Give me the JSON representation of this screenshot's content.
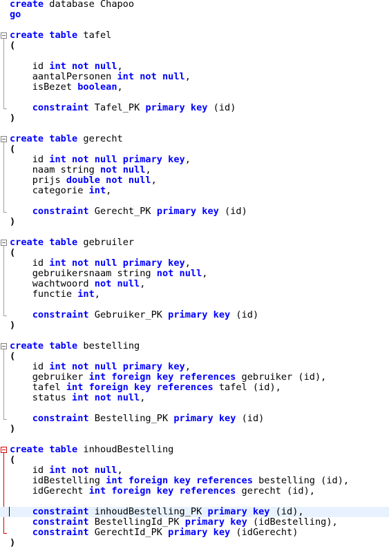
{
  "editor": {
    "current_line": 50,
    "caret_line": 50,
    "fold_regions": [
      {
        "start": 4,
        "end": 11,
        "active": false
      },
      {
        "start": 14,
        "end": 21,
        "active": false
      },
      {
        "start": 24,
        "end": 31,
        "active": false
      },
      {
        "start": 34,
        "end": 41,
        "active": false
      },
      {
        "start": 44,
        "end": 52,
        "active": true
      }
    ],
    "lines": [
      [
        {
          "t": "create",
          "c": "kw"
        },
        {
          "t": " database Chapoo",
          "c": "id"
        }
      ],
      [
        {
          "t": "go",
          "c": "kw"
        }
      ],
      [],
      [
        {
          "t": "create",
          "c": "kw"
        },
        {
          "t": " ",
          "c": "id"
        },
        {
          "t": "table",
          "c": "kw"
        },
        {
          "t": " tafel",
          "c": "id"
        }
      ],
      [
        {
          "t": "(",
          "c": "paren"
        }
      ],
      [],
      [
        {
          "t": "    id ",
          "c": "id"
        },
        {
          "t": "int not null",
          "c": "kw"
        },
        {
          "t": ",",
          "c": "id"
        }
      ],
      [
        {
          "t": "    aantalPersonen ",
          "c": "id"
        },
        {
          "t": "int not null",
          "c": "kw"
        },
        {
          "t": ",",
          "c": "id"
        }
      ],
      [
        {
          "t": "    isBezet ",
          "c": "id"
        },
        {
          "t": "boolean",
          "c": "kw"
        },
        {
          "t": ",",
          "c": "id"
        }
      ],
      [],
      [
        {
          "t": "    ",
          "c": "id"
        },
        {
          "t": "constraint",
          "c": "kw"
        },
        {
          "t": " Tafel_PK ",
          "c": "id"
        },
        {
          "t": "primary key",
          "c": "kw"
        },
        {
          "t": " (id)",
          "c": "id"
        }
      ],
      [
        {
          "t": ")",
          "c": "paren"
        }
      ],
      [],
      [
        {
          "t": "create",
          "c": "kw"
        },
        {
          "t": " ",
          "c": "id"
        },
        {
          "t": "table",
          "c": "kw"
        },
        {
          "t": " gerecht",
          "c": "id"
        }
      ],
      [
        {
          "t": "(",
          "c": "paren"
        }
      ],
      [
        {
          "t": "    id ",
          "c": "id"
        },
        {
          "t": "int not null primary key",
          "c": "kw"
        },
        {
          "t": ",",
          "c": "id"
        }
      ],
      [
        {
          "t": "    naam string ",
          "c": "id"
        },
        {
          "t": "not null",
          "c": "kw"
        },
        {
          "t": ",",
          "c": "id"
        }
      ],
      [
        {
          "t": "    prijs ",
          "c": "id"
        },
        {
          "t": "double not null",
          "c": "kw"
        },
        {
          "t": ",",
          "c": "id"
        }
      ],
      [
        {
          "t": "    categorie ",
          "c": "id"
        },
        {
          "t": "int",
          "c": "kw"
        },
        {
          "t": ",",
          "c": "id"
        }
      ],
      [],
      [
        {
          "t": "    ",
          "c": "id"
        },
        {
          "t": "constraint",
          "c": "kw"
        },
        {
          "t": " Gerecht_PK ",
          "c": "id"
        },
        {
          "t": "primary key",
          "c": "kw"
        },
        {
          "t": " (id)",
          "c": "id"
        }
      ],
      [
        {
          "t": ")",
          "c": "paren"
        }
      ],
      [],
      [
        {
          "t": "create",
          "c": "kw"
        },
        {
          "t": " ",
          "c": "id"
        },
        {
          "t": "table",
          "c": "kw"
        },
        {
          "t": " gebruiler",
          "c": "id"
        }
      ],
      [
        {
          "t": "(",
          "c": "paren"
        }
      ],
      [
        {
          "t": "    id ",
          "c": "id"
        },
        {
          "t": "int not null primary key",
          "c": "kw"
        },
        {
          "t": ",",
          "c": "id"
        }
      ],
      [
        {
          "t": "    gebruikersnaam string ",
          "c": "id"
        },
        {
          "t": "not null",
          "c": "kw"
        },
        {
          "t": ",",
          "c": "id"
        }
      ],
      [
        {
          "t": "    wachtwoord ",
          "c": "id"
        },
        {
          "t": "not null",
          "c": "kw"
        },
        {
          "t": ",",
          "c": "id"
        }
      ],
      [
        {
          "t": "    functie ",
          "c": "id"
        },
        {
          "t": "int",
          "c": "kw"
        },
        {
          "t": ",",
          "c": "id"
        }
      ],
      [],
      [
        {
          "t": "    ",
          "c": "id"
        },
        {
          "t": "constraint",
          "c": "kw"
        },
        {
          "t": " Gebruiker_PK ",
          "c": "id"
        },
        {
          "t": "primary key",
          "c": "kw"
        },
        {
          "t": " (id)",
          "c": "id"
        }
      ],
      [
        {
          "t": ")",
          "c": "paren"
        }
      ],
      [],
      [
        {
          "t": "create",
          "c": "kw"
        },
        {
          "t": " ",
          "c": "id"
        },
        {
          "t": "table",
          "c": "kw"
        },
        {
          "t": " bestelling",
          "c": "id"
        }
      ],
      [
        {
          "t": "(",
          "c": "paren"
        }
      ],
      [
        {
          "t": "    id ",
          "c": "id"
        },
        {
          "t": "int not null primary key",
          "c": "kw"
        },
        {
          "t": ",",
          "c": "id"
        }
      ],
      [
        {
          "t": "    gebruiker ",
          "c": "id"
        },
        {
          "t": "int foreign key references",
          "c": "kw"
        },
        {
          "t": " gebruiker (id),",
          "c": "id"
        }
      ],
      [
        {
          "t": "    tafel ",
          "c": "id"
        },
        {
          "t": "int foreign key references",
          "c": "kw"
        },
        {
          "t": " tafel (id),",
          "c": "id"
        }
      ],
      [
        {
          "t": "    status ",
          "c": "id"
        },
        {
          "t": "int not null",
          "c": "kw"
        },
        {
          "t": ",",
          "c": "id"
        }
      ],
      [],
      [
        {
          "t": "    ",
          "c": "id"
        },
        {
          "t": "constraint",
          "c": "kw"
        },
        {
          "t": " Bestelling_PK ",
          "c": "id"
        },
        {
          "t": "primary key",
          "c": "kw"
        },
        {
          "t": " (id)",
          "c": "id"
        }
      ],
      [
        {
          "t": ")",
          "c": "paren"
        }
      ],
      [],
      [
        {
          "t": "create",
          "c": "kw"
        },
        {
          "t": " ",
          "c": "id"
        },
        {
          "t": "table",
          "c": "kw"
        },
        {
          "t": " inhoudBestelling",
          "c": "id"
        }
      ],
      [
        {
          "t": "(",
          "c": "paren"
        }
      ],
      [
        {
          "t": "    id ",
          "c": "id"
        },
        {
          "t": "int not null",
          "c": "kw"
        },
        {
          "t": ",",
          "c": "id"
        }
      ],
      [
        {
          "t": "    idBestelling ",
          "c": "id"
        },
        {
          "t": "int foreign key references",
          "c": "kw"
        },
        {
          "t": " bestelling (id),",
          "c": "id"
        }
      ],
      [
        {
          "t": "    idGerecht ",
          "c": "id"
        },
        {
          "t": "int foreign key references",
          "c": "kw"
        },
        {
          "t": " gerecht (id),",
          "c": "id"
        }
      ],
      [],
      [
        {
          "t": "    ",
          "c": "id"
        },
        {
          "t": "constraint",
          "c": "kw"
        },
        {
          "t": " inhoudBestelling_PK ",
          "c": "id"
        },
        {
          "t": "primary key",
          "c": "kw"
        },
        {
          "t": " (id),",
          "c": "id"
        }
      ],
      [
        {
          "t": "    ",
          "c": "id"
        },
        {
          "t": "constraint",
          "c": "kw"
        },
        {
          "t": " BestellingId_PK ",
          "c": "id"
        },
        {
          "t": "primary key",
          "c": "kw"
        },
        {
          "t": " (idBestelling),",
          "c": "id"
        }
      ],
      [
        {
          "t": "    ",
          "c": "id"
        },
        {
          "t": "constraint",
          "c": "kw"
        },
        {
          "t": " GerechtId_PK ",
          "c": "id"
        },
        {
          "t": "primary key",
          "c": "kw"
        },
        {
          "t": " (idGerecht)",
          "c": "id"
        }
      ],
      [
        {
          "t": ")",
          "c": "paren"
        }
      ]
    ]
  }
}
